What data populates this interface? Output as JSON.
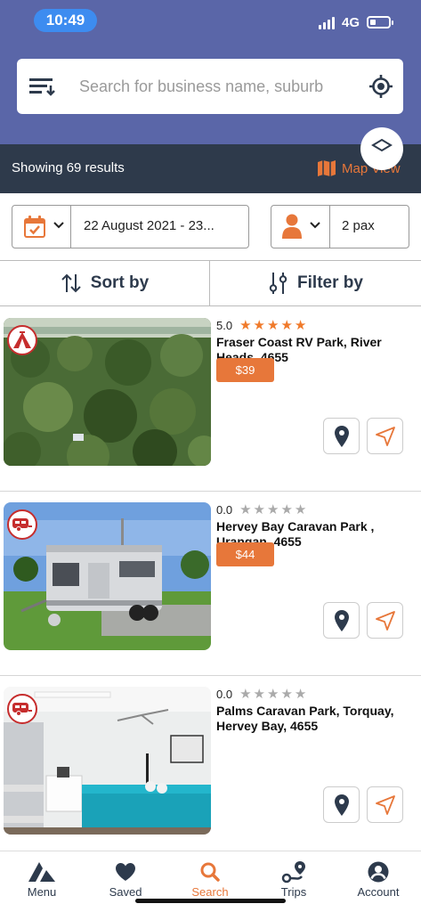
{
  "status_bar": {
    "time": "10:49",
    "network": "4G"
  },
  "search": {
    "placeholder": "Search for business name, suburb"
  },
  "results": {
    "text": "Showing 69 results",
    "map_view_label": "Map View"
  },
  "booking": {
    "date_range": "22 August 2021 - 23...",
    "pax": "2 pax"
  },
  "toolbar": {
    "sort_label": "Sort by",
    "filter_label": "Filter by"
  },
  "listings": [
    {
      "rating": "5.0",
      "stars": 5,
      "name": "Fraser Coast RV Park, River Heads, 4655",
      "price": "$39",
      "category_icon": "tent-icon"
    },
    {
      "rating": "0.0",
      "stars": 0,
      "name": "Hervey Bay Caravan Park , Urangan, 4655",
      "price": "$44",
      "category_icon": "caravan-icon"
    },
    {
      "rating": "0.0",
      "stars": 0,
      "name": "Palms Caravan Park, Torquay, Hervey Bay, 4655",
      "price": "",
      "category_icon": "caravan-icon"
    }
  ],
  "tabs": [
    {
      "label": "Menu",
      "icon": "menu-logo-icon"
    },
    {
      "label": "Saved",
      "icon": "heart-icon"
    },
    {
      "label": "Search",
      "icon": "search-icon",
      "active": true
    },
    {
      "label": "Trips",
      "icon": "route-icon"
    },
    {
      "label": "Account",
      "icon": "account-icon"
    }
  ],
  "colors": {
    "header": "#5a66a8",
    "results_bar": "#2e3a4b",
    "accent": "#e7773a",
    "star": "#f07a2a",
    "badge": "#c62d2d",
    "time_pill": "#3d8cf0"
  }
}
